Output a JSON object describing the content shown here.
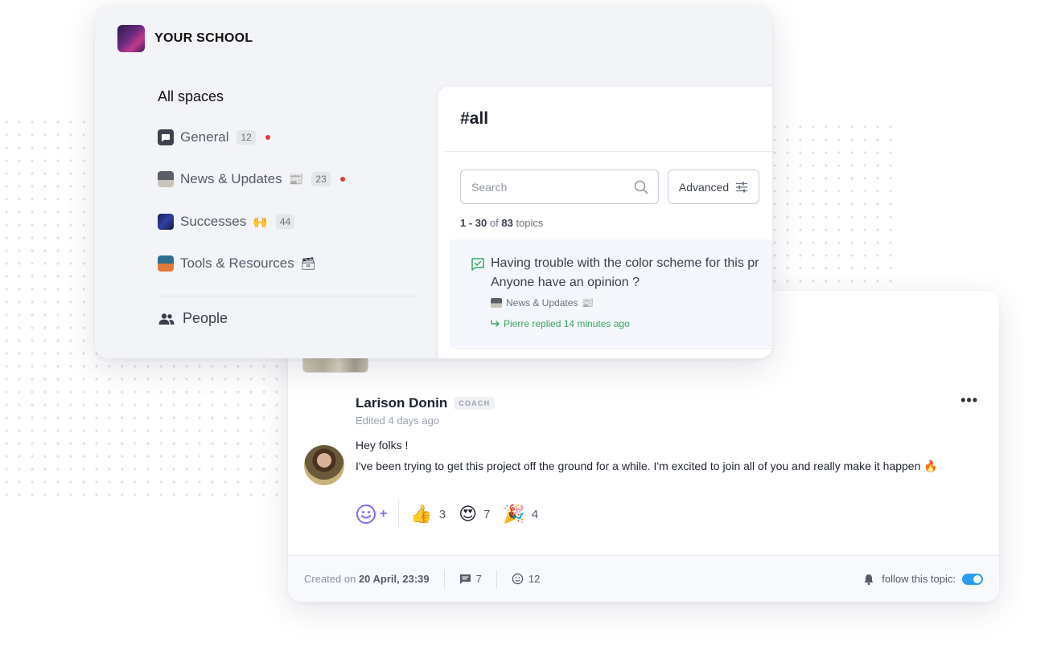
{
  "school": {
    "name": "YOUR SCHOOL"
  },
  "sidebar": {
    "spaces_title": "All spaces",
    "spaces": [
      {
        "label": "General",
        "count": "12",
        "unread": true,
        "icon": "chat-icon",
        "deco": ""
      },
      {
        "label": "News & Updates",
        "count": "23",
        "unread": true,
        "icon": "newspaper-icon",
        "deco": "📰"
      },
      {
        "label": "Successes",
        "count": "44",
        "unread": false,
        "icon": "rocket-icon",
        "deco": "🙌"
      },
      {
        "label": "Tools & Resources",
        "count": "",
        "unread": false,
        "icon": "book-icon",
        "deco": "🗃"
      }
    ],
    "people_label": "People"
  },
  "main": {
    "channel_title": "#all",
    "search_placeholder": "Search",
    "advanced_label": "Advanced",
    "range": {
      "start": "1 - 30",
      "of_word": "of",
      "total": "83",
      "suffix": "topics"
    },
    "topic": {
      "title_line1": "Having trouble with the color scheme for this pr",
      "title_line2": "Anyone have an opinion ?",
      "space": "News & Updates",
      "space_deco": "📰",
      "reply": "Pierre replied 14 minutes ago"
    }
  },
  "post": {
    "author": "Larison Donin",
    "badge": "COACH",
    "edited": "Edited 4 days ago",
    "line1": "Hey folks !",
    "line2": "I've been trying to get this project off the ground for a while. I'm excited to join all of you and really make it happen 🔥",
    "more_label": "•••",
    "reactions": [
      {
        "emoji": "👍",
        "count": "3",
        "name": "thumbs-up"
      },
      {
        "emoji": "😍",
        "count": "7",
        "name": "heart-eyes"
      },
      {
        "emoji": "🎉",
        "count": "4",
        "name": "party-popper"
      }
    ],
    "footer": {
      "created_prefix": "Created on",
      "created_date": "20 April, 23:39",
      "comments": "7",
      "reactions": "12",
      "follow_label": "follow this topic:"
    }
  },
  "colors": {
    "accent": "#2d9cf0",
    "unread": "#e53935",
    "reply_green": "#3aa560",
    "reaction_purple": "#7a6bf0"
  }
}
